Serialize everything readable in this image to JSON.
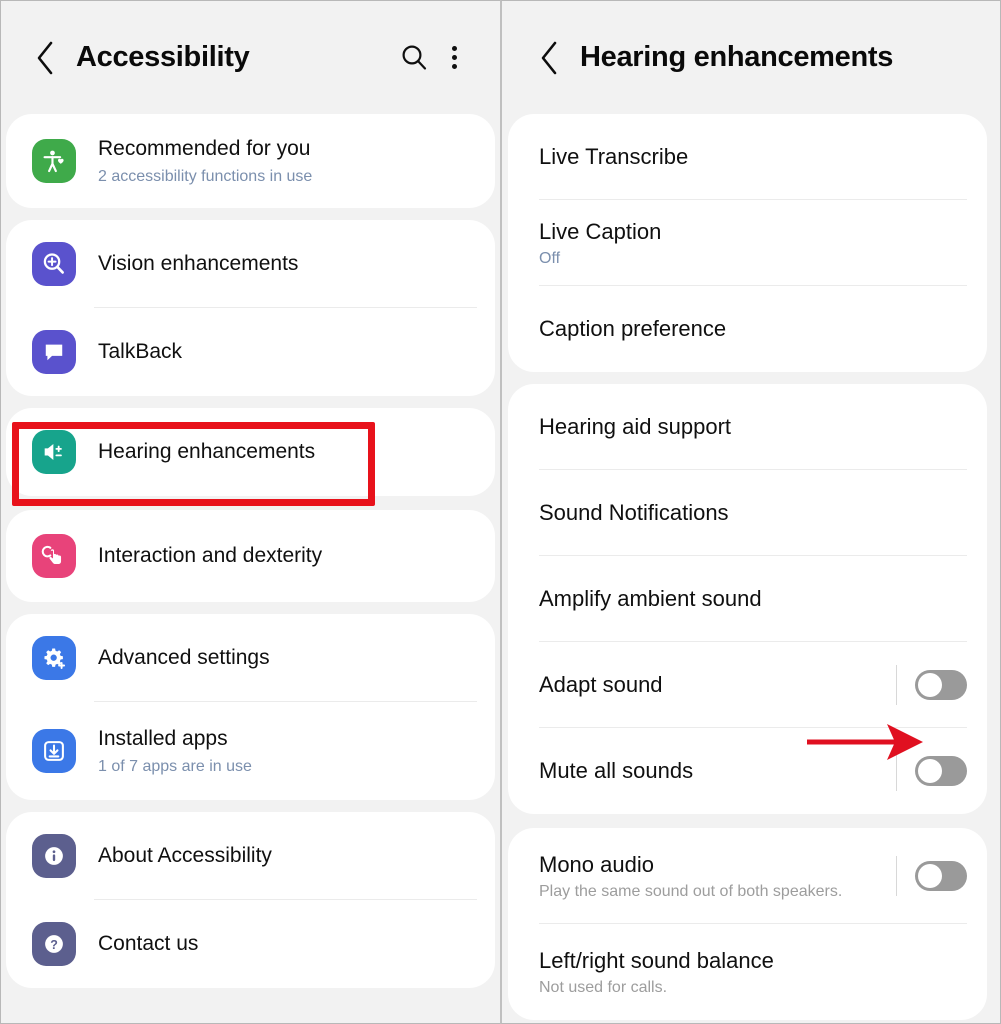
{
  "left_panel": {
    "header": {
      "back_icon": "chevron-left-icon",
      "title": "Accessibility",
      "search_icon": "search-icon",
      "more_icon": "more-options-icon"
    },
    "sections": [
      {
        "items": [
          {
            "icon": "accessibility-person-icon",
            "icon_color": "#3faa4a",
            "title": "Recommended for you",
            "subtitle": "2 accessibility functions in use",
            "badge": false
          }
        ]
      },
      {
        "items": [
          {
            "icon": "magnifier-plus-icon",
            "icon_color": "#5a52cd",
            "title": "Vision enhancements",
            "subtitle": "",
            "badge": false
          },
          {
            "icon": "speech-bubble-icon",
            "icon_color": "#5a52cd",
            "title": "TalkBack",
            "subtitle": "",
            "badge": false
          }
        ]
      },
      {
        "items": [
          {
            "icon": "speaker-plusminus-icon",
            "icon_color": "#17a48c",
            "title": "Hearing enhancements",
            "subtitle": "",
            "badge": false
          }
        ]
      },
      {
        "items": [
          {
            "icon": "hand-tap-icon",
            "icon_color": "#e8437a",
            "title": "Interaction and dexterity",
            "subtitle": "",
            "badge": false
          }
        ]
      },
      {
        "items": [
          {
            "icon": "gear-plus-icon",
            "icon_color": "#3b78e7",
            "title": "Advanced settings",
            "subtitle": "",
            "badge": false
          },
          {
            "icon": "download-box-icon",
            "icon_color": "#3b78e7",
            "title": "Installed apps",
            "subtitle": "1 of 7 apps are in use",
            "badge": true
          }
        ]
      },
      {
        "items": [
          {
            "icon": "info-circle-icon",
            "icon_color": "#5c5f8e",
            "title": "About Accessibility",
            "subtitle": "",
            "badge": false
          },
          {
            "icon": "question-circle-icon",
            "icon_color": "#5c5f8e",
            "title": "Contact us",
            "subtitle": "",
            "badge": false
          }
        ]
      }
    ],
    "badge_color": "#e8622a",
    "highlight_color": "#e8121b"
  },
  "right_panel": {
    "header": {
      "back_icon": "chevron-left-icon",
      "title": "Hearing enhancements"
    },
    "sections": [
      {
        "items": [
          {
            "title": "Live Transcribe",
            "subtitle": "",
            "subtitle_style": "link",
            "toggle": null
          },
          {
            "title": "Live Caption",
            "subtitle": "Off",
            "subtitle_style": "link",
            "toggle": null
          },
          {
            "title": "Caption preference",
            "subtitle": "",
            "subtitle_style": "link",
            "toggle": null
          }
        ]
      },
      {
        "items": [
          {
            "title": "Hearing aid support",
            "subtitle": "",
            "subtitle_style": "link",
            "toggle": null
          },
          {
            "title": "Sound Notifications",
            "subtitle": "",
            "subtitle_style": "link",
            "toggle": null
          },
          {
            "title": "Amplify ambient sound",
            "subtitle": "",
            "subtitle_style": "link",
            "toggle": null
          },
          {
            "title": "Adapt sound",
            "subtitle": "",
            "subtitle_style": "link",
            "toggle": "off"
          },
          {
            "title": "Mute all sounds",
            "subtitle": "",
            "subtitle_style": "link",
            "toggle": "off"
          }
        ]
      },
      {
        "items": [
          {
            "title": "Mono audio",
            "subtitle": "Play the same sound out of both speakers.",
            "subtitle_style": "grey",
            "toggle": "off"
          },
          {
            "title": "Left/right sound balance",
            "subtitle": "Not used for calls.",
            "subtitle_style": "grey",
            "toggle": null
          }
        ]
      }
    ],
    "annotation_arrow": "red-arrow-pointing-right-at-mute-all-sounds-toggle"
  }
}
